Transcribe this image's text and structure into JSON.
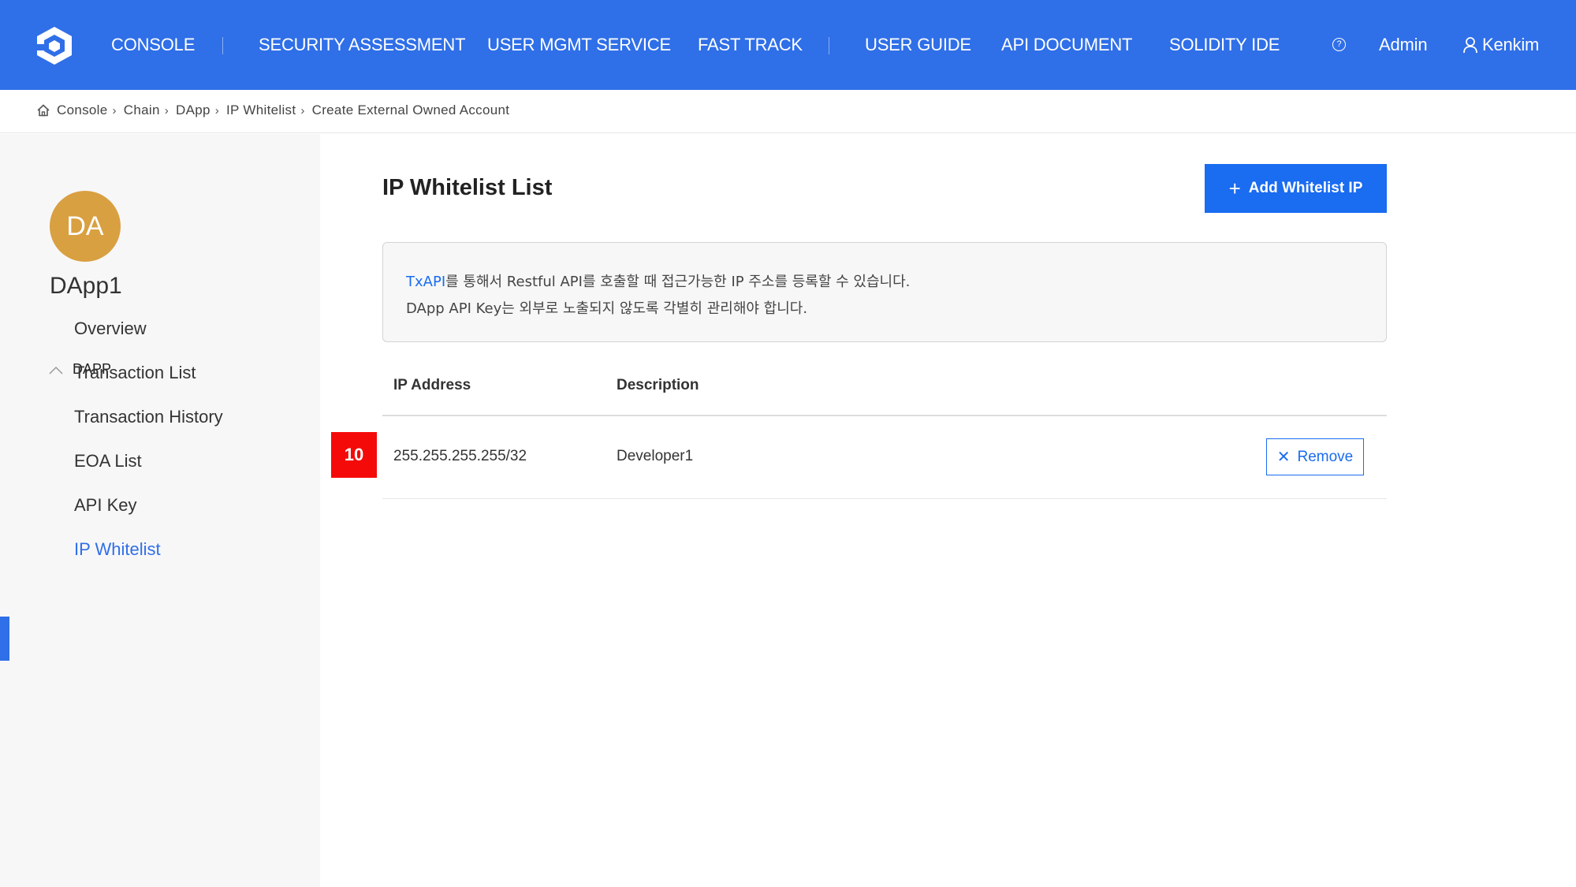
{
  "nav": {
    "items": [
      "CONSOLE",
      "SECURITY ASSESSMENT",
      "USER MGMT SERVICE",
      "FAST TRACK",
      "USER GUIDE",
      "API DOCUMENT",
      "SOLIDITY IDE"
    ],
    "help": "?",
    "admin": "Admin",
    "user": "Kenkim",
    "color": "#2f6fe8"
  },
  "breadcrumb": [
    "Console",
    "Chain",
    "DApp",
    "IP Whitelist",
    "Create External Owned Account"
  ],
  "sidebar": {
    "avatar": "DA",
    "avatar_color": "#d9a041",
    "dapp_name": "DApp1",
    "section": "DAPP",
    "items": [
      "Overview",
      "Transaction List",
      "Transaction History",
      "EOA List",
      "API Key",
      "IP Whitelist"
    ],
    "active": "IP Whitelist"
  },
  "main": {
    "title": "IP Whitelist List",
    "add_button": "Add Whitelist IP",
    "info_link": "TxAPI",
    "info_line1": "를 통해서 Restful API를 호출할 때 접근가능한 IP 주소를 등록할 수 있습니다.",
    "info_line2": "DApp API Key는 외부로 노출되지 않도록 각별히 관리해야 합니다.",
    "table": {
      "headers": [
        "IP Address",
        "Description"
      ],
      "rows": [
        {
          "ip": "255.255.255.255/32",
          "description": "Developer1",
          "action": "Remove"
        }
      ]
    },
    "badge": "10"
  }
}
